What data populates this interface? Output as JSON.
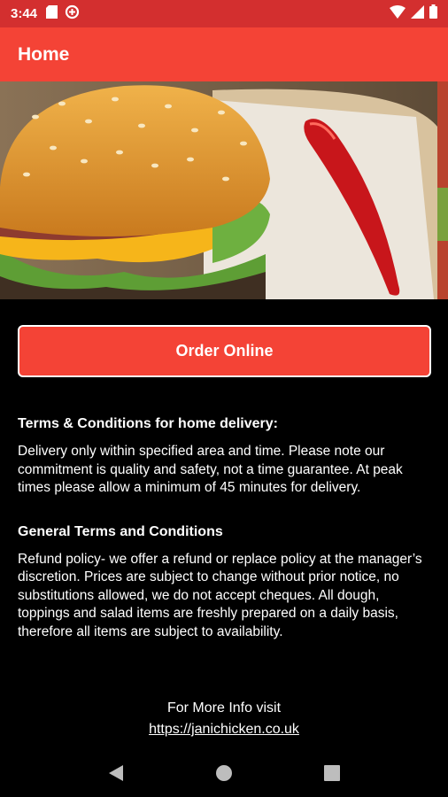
{
  "status_bar": {
    "time": "3:44",
    "left_icons": [
      "sd-card-icon",
      "data-saver-icon"
    ],
    "right_icons": [
      "wifi-icon",
      "signal-icon",
      "battery-icon"
    ]
  },
  "app_bar": {
    "title": "Home"
  },
  "banner": {
    "slide_count": 4,
    "active_slide": 1
  },
  "order_button": {
    "label": "Order Online"
  },
  "terms": {
    "delivery_title": "Terms & Conditions for home delivery:",
    "delivery_body": "Delivery only within specified area and time. Please note our commitment is quality and safety, not a time guarantee. At peak times please allow a minimum of 45 minutes for delivery.",
    "general_title": "General Terms and Conditions",
    "general_body": "Refund policy- we offer a refund or replace policy at the manager’s discretion. Prices are subject to change without prior notice, no substitutions allowed, we do not accept cheques. All dough, toppings and salad items are freshly prepared on a daily basis, therefore all items are subject to availability."
  },
  "footer": {
    "label": "For More Info visit",
    "link": "https://janichicken.co.uk"
  },
  "colors": {
    "status_bar": "#d32f2f",
    "app_bar": "#f44336",
    "button": "#f44336",
    "background": "#000000"
  }
}
